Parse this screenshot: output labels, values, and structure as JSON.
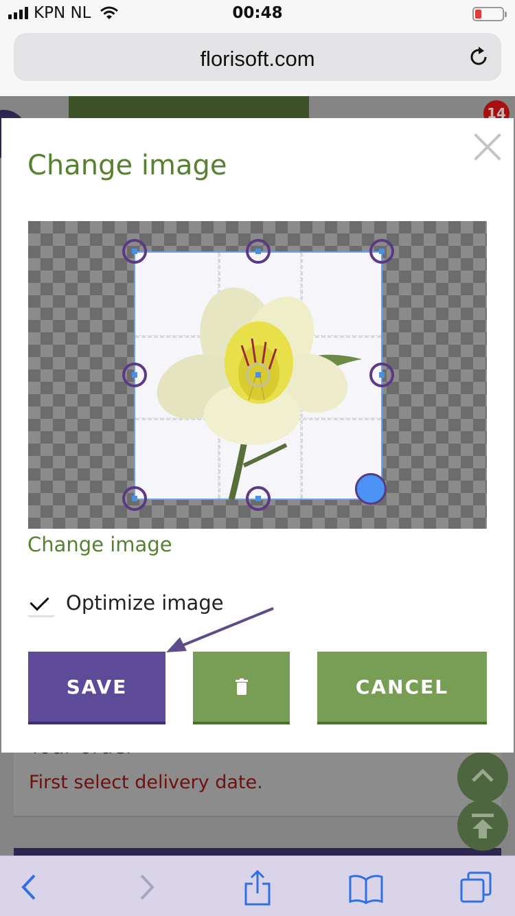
{
  "status_bar": {
    "carrier": "KPN NL",
    "time": "00:48",
    "battery_level": 0.22
  },
  "browser": {
    "url": "florisoft.com"
  },
  "background_page": {
    "notification_count": "14",
    "order_title": "Your order",
    "delivery_message": "First select delivery date."
  },
  "modal": {
    "title": "Change image",
    "change_image_link": "Change image",
    "optimize_label": "Optimize image",
    "optimize_checked": true,
    "save_label": "SAVE",
    "cancel_label": "CANCEL"
  },
  "colors": {
    "accent_green": "#56812f",
    "save_purple": "#5d4b99",
    "button_green": "#789e55",
    "error_red": "#a61010"
  }
}
